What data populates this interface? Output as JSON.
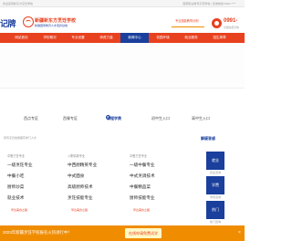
{
  "topbar": {
    "left": "欢迎来到新东方烹饪学校",
    "right": "国家职业教育示范学校  |  咨询热线 0991-****"
  },
  "header": {
    "logo_text": "记牌",
    "school_name": "新疆新东方烹饪学校",
    "school_sub": "新疆国家教育人才培养基地",
    "promo_text": "专业技能教育示例",
    "phone": "0991-",
    "phone_note": "全国免费咨询"
  },
  "nav": {
    "items": [
      {
        "label": "",
        "active": false
      },
      {
        "label": "网站首页",
        "active": false
      },
      {
        "label": "学校概况",
        "active": false
      },
      {
        "label": "专业设置",
        "active": false
      },
      {
        "label": "师资力量",
        "active": false
      },
      {
        "label": "新闻中心",
        "active": true
      },
      {
        "label": "校园环境",
        "active": false
      },
      {
        "label": "就业服务",
        "active": false
      },
      {
        "label": "招生简章",
        "active": false
      }
    ]
  },
  "quick": {
    "items": [
      {
        "label": "西点专区",
        "active": false
      },
      {
        "label": "西餐专区",
        "active": false
      },
      {
        "label": "课程学费",
        "active": true
      },
      {
        "label": "初中生入口",
        "active": false
      },
      {
        "label": "高中生入口",
        "active": false
      }
    ]
  },
  "search": {
    "hint": "所有烹饪技能都有学门人才"
  },
  "panel": {
    "title": "解疑答惑"
  },
  "cards": [
    {
      "tag": "中餐烹饪专业",
      "rows": [
        "一级烹饪专业",
        "中餐小吃",
        "厨师炒菜",
        "就业技术"
      ],
      "hint": "早达美食之路"
    },
    {
      "tag": "入职精英专业",
      "rows": [
        "中西厨精英专业",
        "中式面食",
        "高级厨师技术",
        "烹饪技能专业"
      ],
      "hint": "早达美食之路"
    },
    {
      "tag": "中餐烹饪专业",
      "rows": [
        "一级中餐专业",
        "中式烹调技术",
        "中餐精品菜",
        "厨师技能专业"
      ],
      "hint": "早达美食之路"
    }
  ],
  "qa": {
    "cells": [
      "就业",
      "学费",
      "热门"
    ],
    "labels": [
      "就业咨询",
      "学费咨询",
      "热门咨询"
    ]
  },
  "footer": {
    "message": "2023年新疆烹饪学校报名火热进行中！",
    "button": "在线申请免费试学",
    "close": "×"
  },
  "colors": {
    "brand_red": "#e8411f",
    "brand_blue": "#1a3f9c",
    "footer_orange": "#f08c00"
  }
}
